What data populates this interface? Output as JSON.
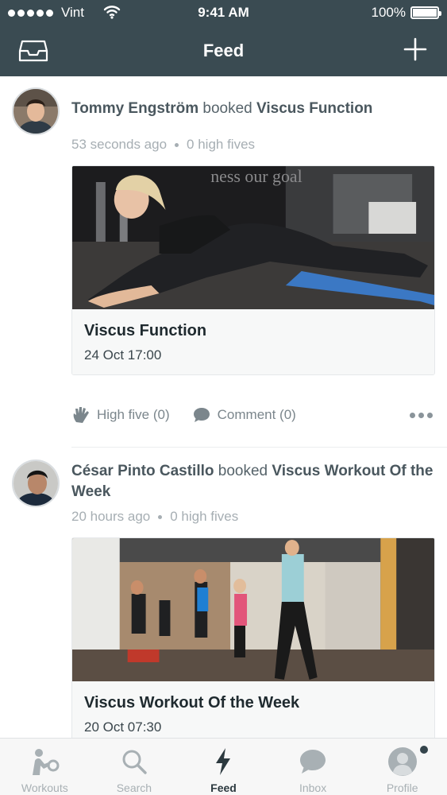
{
  "status_bar": {
    "carrier": "Vint",
    "time": "9:41 AM",
    "battery": "100%"
  },
  "nav": {
    "title": "Feed"
  },
  "feed": [
    {
      "user": "Tommy Engström",
      "verb": "booked",
      "target": "Viscus Function",
      "time_ago": "53 seconds ago",
      "high_fives": "0 high fives",
      "card_title": "Viscus Function",
      "card_date": "24 Oct 17:00",
      "image_caption": "ness our goal",
      "high_five_label": "High five (0)",
      "comment_label": "Comment (0)"
    },
    {
      "user": "César Pinto Castillo",
      "verb": "booked",
      "target": "Viscus Workout Of the Week",
      "time_ago": "20 hours ago",
      "high_fives": "0 high fives",
      "card_title": "Viscus Workout Of the Week",
      "card_date": "20 Oct 07:30"
    }
  ],
  "tabs": [
    {
      "label": "Workouts",
      "icon": "workouts-icon"
    },
    {
      "label": "Search",
      "icon": "search-icon"
    },
    {
      "label": "Feed",
      "icon": "lightning-icon",
      "active": true
    },
    {
      "label": "Inbox",
      "icon": "chat-bubble-icon"
    },
    {
      "label": "Profile",
      "icon": "profile-avatar-icon",
      "notification": true
    }
  ],
  "colors": {
    "header": "#3a4b52",
    "tab_active": "#2c393f",
    "tab_inactive": "#a8b0b4",
    "card_body": "#f7f8f8"
  }
}
